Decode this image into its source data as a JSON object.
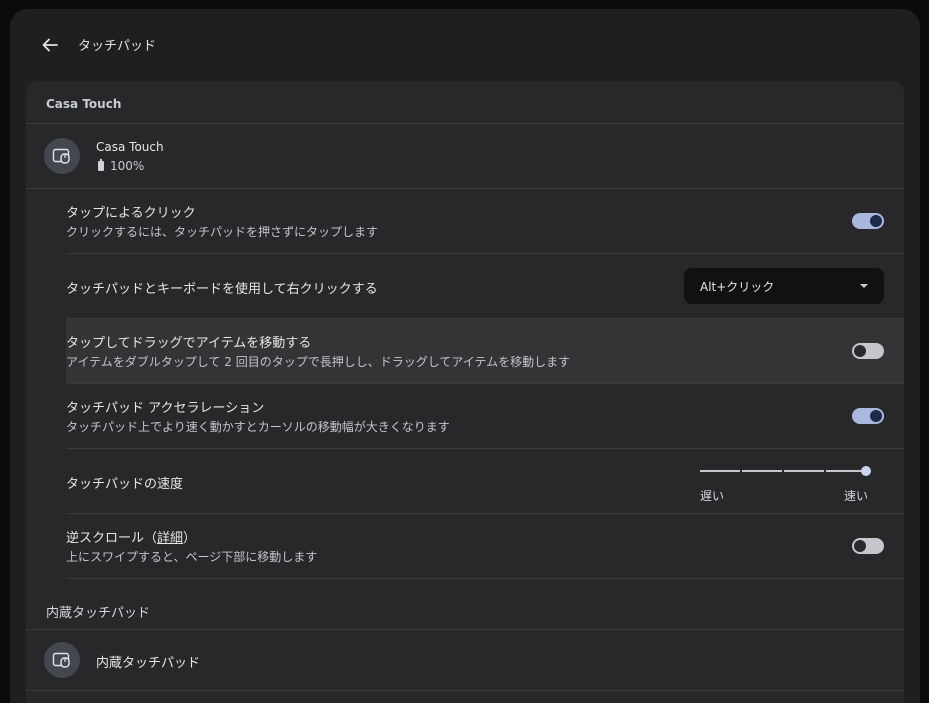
{
  "header": {
    "title": "タッチパッド"
  },
  "section1": {
    "title": "Casa Touch",
    "device": {
      "name": "Casa Touch",
      "battery": "100%"
    }
  },
  "settings": {
    "tap_to_click": {
      "label": "タップによるクリック",
      "desc": "クリックするには、タッチパッドを押さずにタップします",
      "enabled": true
    },
    "right_click": {
      "label": "タッチパッドとキーボードを使用して右クリックする",
      "value": "Alt+クリック"
    },
    "tap_drag": {
      "label": "タップしてドラッグでアイテムを移動する",
      "desc": "アイテムをダブルタップして 2 回目のタップで長押しし、ドラッグしてアイテムを移動します",
      "enabled": false
    },
    "acceleration": {
      "label": "タッチパッド アクセラレーション",
      "desc": "タッチパッド上でより速く動かすとカーソルの移動幅が大きくなります",
      "enabled": true
    },
    "speed": {
      "label": "タッチパッドの速度",
      "min_label": "遅い",
      "max_label": "速い",
      "value": 1.0
    },
    "reverse_scroll": {
      "label_prefix": "逆スクロール（",
      "label_link": "詳細",
      "label_suffix": "）",
      "desc": "上にスワイプすると、ページ下部に移動します",
      "enabled": false
    }
  },
  "section2": {
    "title": "内蔵タッチパッド",
    "device": {
      "name": "内蔵タッチパッド"
    }
  }
}
